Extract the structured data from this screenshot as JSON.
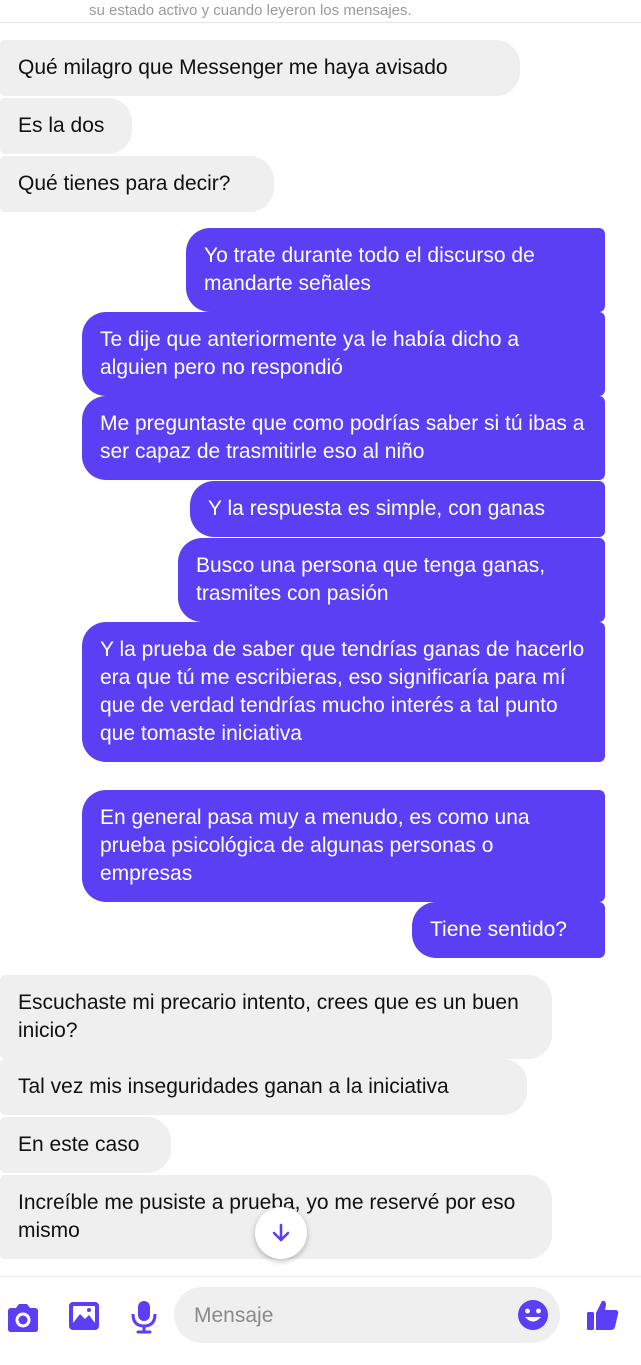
{
  "top_note": "su estado activo y cuando leyeron los mensajes.",
  "messages": [
    {
      "dir": "in",
      "text": "Qué milagro que Messenger me haya avisado"
    },
    {
      "dir": "in",
      "text": "Es la dos"
    },
    {
      "dir": "in",
      "text": "Qué tienes para decir?"
    },
    {
      "dir": "out",
      "text": "Yo trate durante todo el discurso de mandarte señales"
    },
    {
      "dir": "out",
      "text": "Te dije que anteriormente ya le había dicho a alguien pero no respondió"
    },
    {
      "dir": "out",
      "text": "Me preguntaste que como podrías saber si tú ibas a ser capaz de trasmitirle eso al niño"
    },
    {
      "dir": "out",
      "text": "Y la respuesta es simple, con ganas"
    },
    {
      "dir": "out",
      "text": "Busco una persona que tenga ganas, trasmites con pasión"
    },
    {
      "dir": "out",
      "text": "Y la prueba de saber que tendrías ganas de hacerlo era que tú me escribieras, eso significaría para mí que de verdad tendrías mucho interés a tal punto que tomaste iniciativa"
    },
    {
      "dir": "out",
      "text": "En general pasa muy a menudo, es como una prueba psicológica de algunas personas o empresas"
    },
    {
      "dir": "out",
      "text": "Tiene sentido?"
    },
    {
      "dir": "in",
      "text": "Escuchaste mi precario intento, crees que es un buen inicio?"
    },
    {
      "dir": "in",
      "text": "Tal vez mis inseguridades ganan a la iniciativa"
    },
    {
      "dir": "in",
      "text": "En este caso"
    },
    {
      "dir": "in",
      "text": "Increíble me pusiste a prueba, yo me reservé por eso mismo"
    }
  ],
  "composer": {
    "placeholder": "Mensaje",
    "icons": [
      "camera-icon",
      "gallery-icon",
      "microphone-icon",
      "emoji-icon",
      "like-icon"
    ]
  },
  "colors": {
    "accent": "#5b3ff5",
    "incoming_bubble": "#efefef",
    "outgoing_text": "#ffffff"
  }
}
